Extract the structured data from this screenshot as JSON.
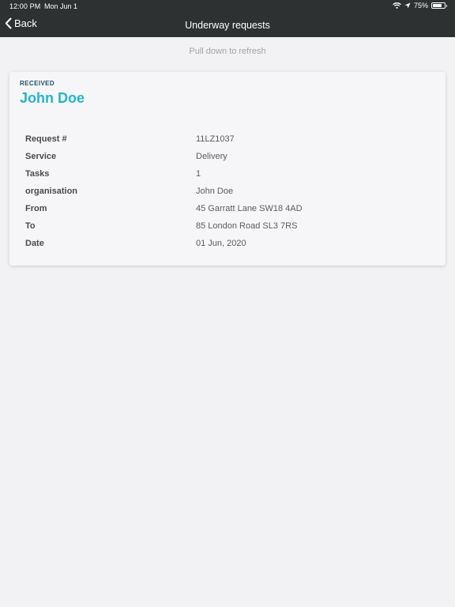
{
  "status_bar": {
    "time": "12:00 PM",
    "date": "Mon Jun 1",
    "battery": "75%",
    "battery_level": 0.75
  },
  "nav": {
    "back_label": "Back",
    "title": "Underway requests"
  },
  "refresh_hint": "Pull down to refresh",
  "request": {
    "status": "RECEIVED",
    "name": "John Doe",
    "fields": [
      {
        "label": "Request #",
        "value": "11LZ1037"
      },
      {
        "label": "Service",
        "value": "Delivery"
      },
      {
        "label": "Tasks",
        "value": "1"
      },
      {
        "label": "organisation",
        "value": "John Doe"
      },
      {
        "label": "From",
        "value": "45 Garratt Lane SW18 4AD"
      },
      {
        "label": "To",
        "value": "85 London Road SL3 7RS"
      },
      {
        "label": "Date",
        "value": "01 Jun, 2020"
      }
    ]
  },
  "colors": {
    "nav_background": "#2e3132",
    "accent": "#24b5c9",
    "status_text": "#1c4f6e",
    "page_background": "#f2f2f5"
  },
  "icons": [
    "wifi-icon",
    "location-icon",
    "battery-icon",
    "chevron-left-icon"
  ]
}
